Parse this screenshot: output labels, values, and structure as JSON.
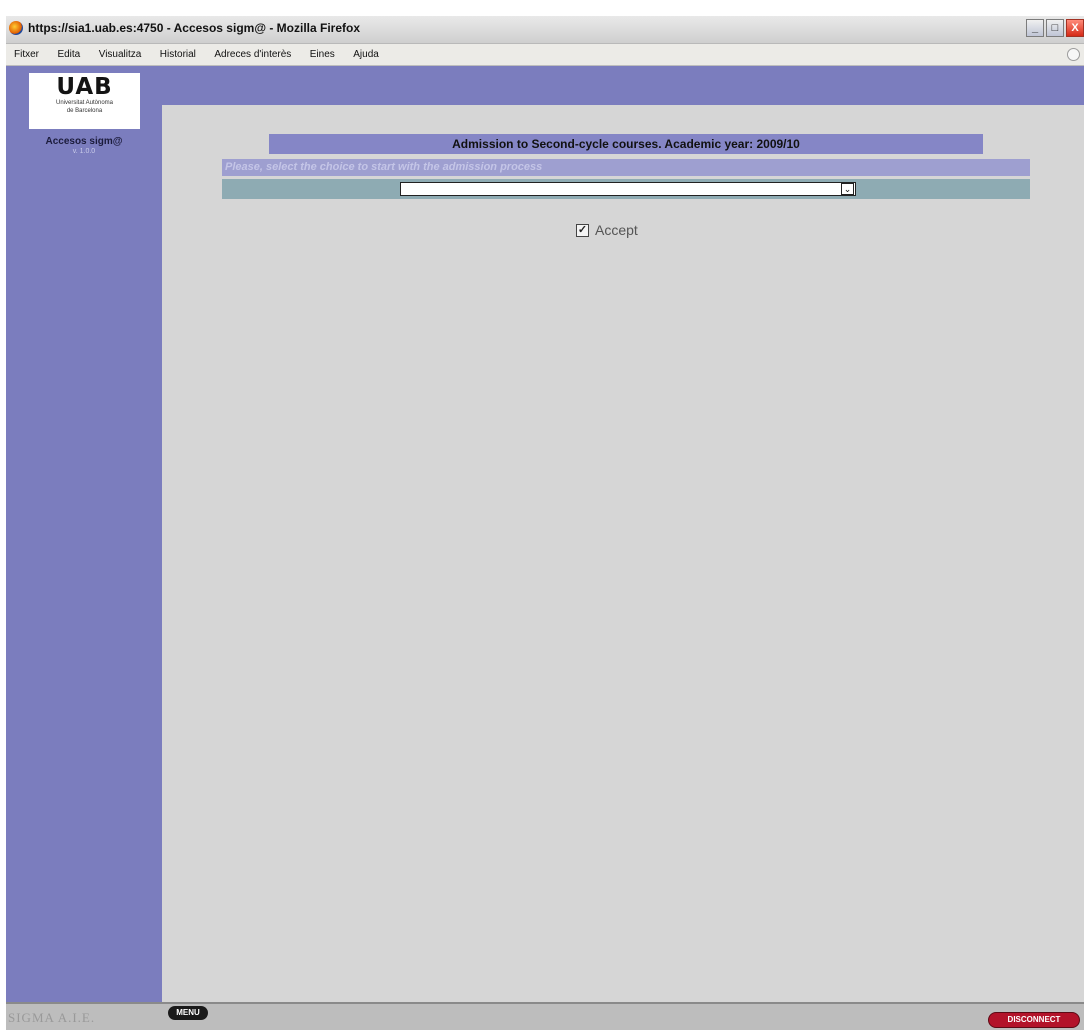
{
  "window": {
    "title": "https://sia1.uab.es:4750 - Accesos sigm@ - Mozilla Firefox",
    "buttons": {
      "minimize": "_",
      "maximize": "□",
      "close": "X"
    }
  },
  "menubar": {
    "items": [
      "Fitxer",
      "Edita",
      "Visualitza",
      "Historial",
      "Adreces d'interès",
      "Eines",
      "Ajuda"
    ]
  },
  "sidebar": {
    "logo_mark": "UAB",
    "logo_line1": "Universitat Autònoma",
    "logo_line2": "de Barcelona",
    "app_name": "Accesos sigm@",
    "version": "v. 1.0.0"
  },
  "main": {
    "banner": "Admission to Second-cycle courses. Academic year: 2009/10",
    "prompt": "Please, select the choice to start with the admission process",
    "select_value": "",
    "accept_label": "Accept",
    "accept_checked": true
  },
  "bottombar": {
    "brand": "SIGMA A.I.E.",
    "menu_label": "MENU",
    "disconnect_label": "DISCONNECT"
  },
  "colors": {
    "sidebar": "#7b7dbe",
    "banner": "#8586c6",
    "prompt_bg": "#9e9fd0",
    "select_row": "#8eabb3",
    "content_bg": "#d6d6d6",
    "disconnect": "#b3132a"
  }
}
